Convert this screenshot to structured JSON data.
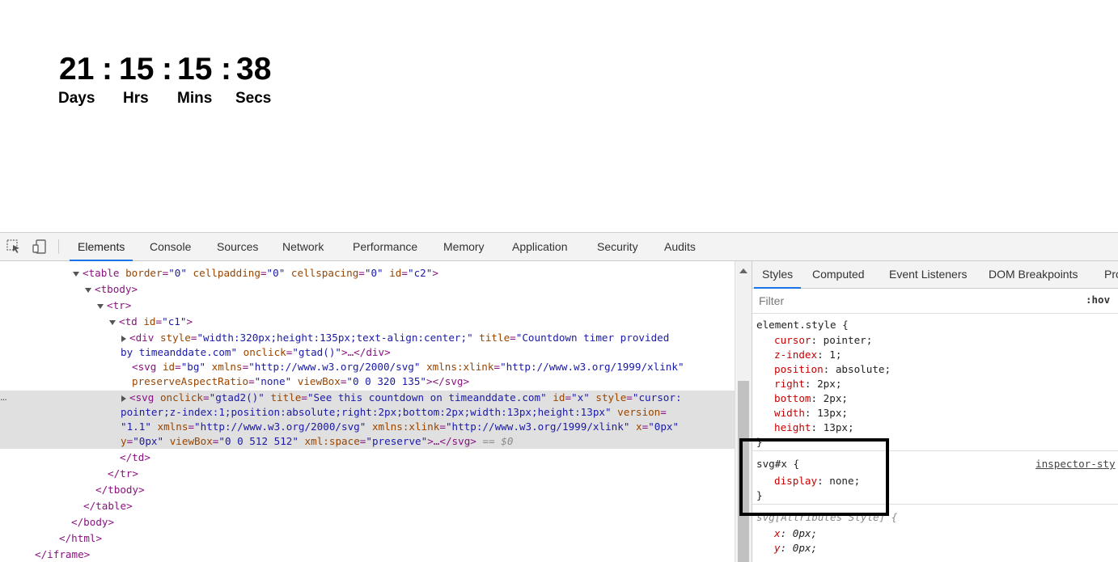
{
  "countdown": {
    "days": "21",
    "hours": "15",
    "mins": "15",
    "secs": "38",
    "separator": ":",
    "labels": {
      "days": "Days",
      "hours": "Hrs",
      "mins": "Mins",
      "secs": "Secs"
    }
  },
  "devtools": {
    "tabs": [
      "Elements",
      "Console",
      "Sources",
      "Network",
      "Performance",
      "Memory",
      "Application",
      "Security",
      "Audits"
    ],
    "active_tab": "Elements",
    "icons": {
      "inspect": "inspect-element-icon",
      "device": "device-toolbar-icon"
    },
    "elements": {
      "table_open": {
        "tag": "<table",
        "a1": "border",
        "v1": "\"0\"",
        "a2": "cellpadding",
        "v2": "\"0\"",
        "a3": "cellspacing",
        "v3": "\"0\"",
        "a4": "id",
        "v4": "\"c2\"",
        "close": ">"
      },
      "tbody_open": "<tbody>",
      "tr_open": "<tr>",
      "td_open": {
        "tag": "<td",
        "a1": "id",
        "v1": "\"c1\"",
        "close": ">"
      },
      "div_line1": {
        "tag": "<div",
        "a1": "style",
        "v1": "\"width:320px;height:135px;text-align:center;\"",
        "a2": "title",
        "v2": "\"Countdown timer provided"
      },
      "div_line2": {
        "v2b": "by timeanddate.com\"",
        "a3": "onclick",
        "v3": "\"gtad()\"",
        "tail": ">…</div>"
      },
      "svg_bg_line1": {
        "tag": "<svg",
        "a1": "id",
        "v1": "\"bg\"",
        "a2": "xmlns",
        "v2": "\"http://www.w3.org/2000/svg\"",
        "a3": "xmlns:xlink",
        "v3": "\"http://www.w3.org/1999/xlink\""
      },
      "svg_bg_line2": {
        "a4": "preserveAspectRatio",
        "v4": "\"none\"",
        "a5": "viewBox",
        "v5": "\"0 0 320 135\"",
        "tail": "></svg>"
      },
      "svg_x_line1": {
        "tag": "<svg",
        "a1": "onclick",
        "v1": "\"gtad2()\"",
        "a2": "title",
        "v2": "\"See this countdown on timeanddate.com\"",
        "a3": "id",
        "v3": "\"x\"",
        "a4": "style",
        "v4": "\"cursor:"
      },
      "svg_x_line2": {
        "v4b": "pointer;z-index:1;position:absolute;right:2px;bottom:2px;width:13px;height:13px\"",
        "a5": "version",
        "eq": "="
      },
      "svg_x_line3": {
        "v5": "\"1.1\"",
        "a6": "xmlns",
        "v6": "\"http://www.w3.org/2000/svg\"",
        "a7": "xmlns:xlink",
        "v7": "\"http://www.w3.org/1999/xlink\"",
        "a8": "x",
        "v8": "\"0px\""
      },
      "svg_x_line4": {
        "a9": "y",
        "v9": "\"0px\"",
        "a10": "viewBox",
        "v10": "\"0 0 512 512\"",
        "a11": "xml:space",
        "v11": "\"preserve\"",
        "tail": ">…</svg>",
        "selected_marker": "== $0"
      },
      "td_close": "</td>",
      "tr_close": "</tr>",
      "tbody_close": "</tbody>",
      "table_close": "</table>",
      "body_close": "</body>",
      "html_close": "</html>",
      "iframe_close": "</iframe>",
      "ellipsis": "..."
    },
    "styles_panel": {
      "tabs": [
        "Styles",
        "Computed",
        "Event Listeners",
        "DOM Breakpoints",
        "Pro"
      ],
      "active_tab": "Styles",
      "filter_placeholder": "Filter",
      "hov_label": ":hov",
      "element_style": {
        "selector": "element.style {",
        "props": [
          {
            "name": "cursor",
            "value": "pointer;"
          },
          {
            "name": "z-index",
            "value": "1;"
          },
          {
            "name": "position",
            "value": "absolute;"
          },
          {
            "name": "right",
            "value": "2px;"
          },
          {
            "name": "bottom",
            "value": "2px;"
          },
          {
            "name": "width",
            "value": "13px;"
          },
          {
            "name": "height",
            "value": "13px;"
          }
        ],
        "close": "}"
      },
      "svg_x_rule": {
        "selector": "svg#x {",
        "source": "inspector-sty",
        "props": [
          {
            "name": "display",
            "value": "none;"
          }
        ],
        "close": "}"
      },
      "attributes_rule": {
        "selector": "svg[Attributes Style] {",
        "props": [
          {
            "name": "x",
            "value": "0px;"
          },
          {
            "name": "y",
            "value": "0px;"
          }
        ]
      }
    }
  }
}
